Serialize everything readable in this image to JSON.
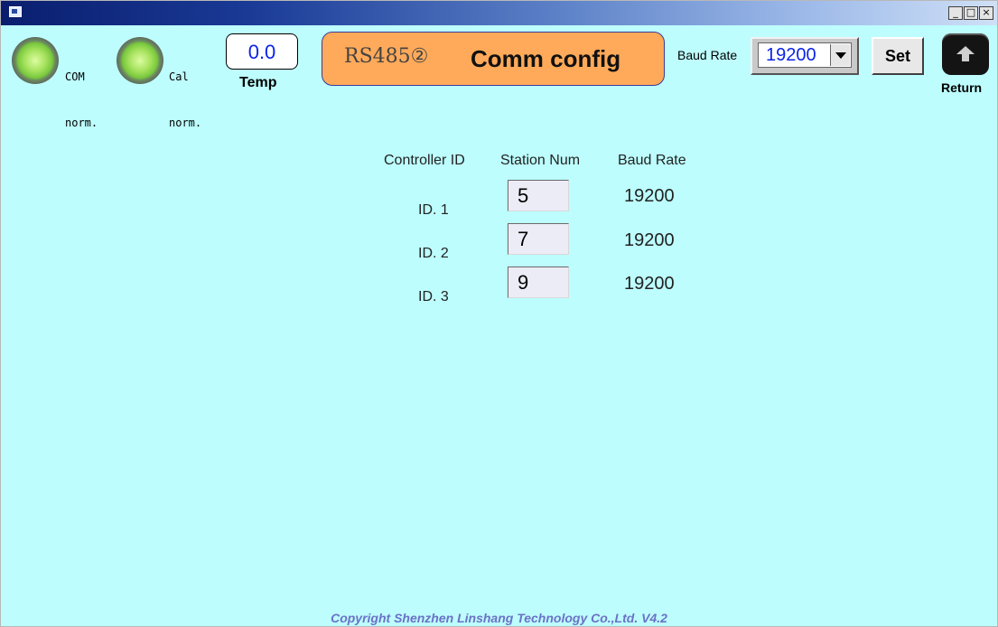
{
  "status": {
    "com": {
      "line1": "COM",
      "line2": "norm."
    },
    "cal": {
      "line1": "Cal",
      "line2": "norm."
    }
  },
  "temp": {
    "value": "0.0",
    "label": "Temp"
  },
  "banner": {
    "interface": "RS485②",
    "title": "Comm config"
  },
  "baud": {
    "label": "Baud Rate",
    "selected": "19200"
  },
  "buttons": {
    "set": "Set",
    "return": "Return"
  },
  "table": {
    "headers": [
      "Controller ID",
      "Station Num",
      "Baud Rate"
    ],
    "rows": [
      {
        "id": "ID. 1",
        "station": "5",
        "baud": "19200"
      },
      {
        "id": "ID. 2",
        "station": "7",
        "baud": "19200"
      },
      {
        "id": "ID. 3",
        "station": "9",
        "baud": "19200"
      }
    ]
  },
  "footer": "Copyright Shenzhen Linshang Technology Co.,Ltd. V4.2",
  "colors": {
    "background": "#bdfdfd",
    "banner": "#ffaa5a",
    "value_blue": "#0b24e6"
  },
  "icons": [
    "minimize-icon",
    "maximize-icon",
    "close-icon",
    "return-arrow-icon"
  ]
}
